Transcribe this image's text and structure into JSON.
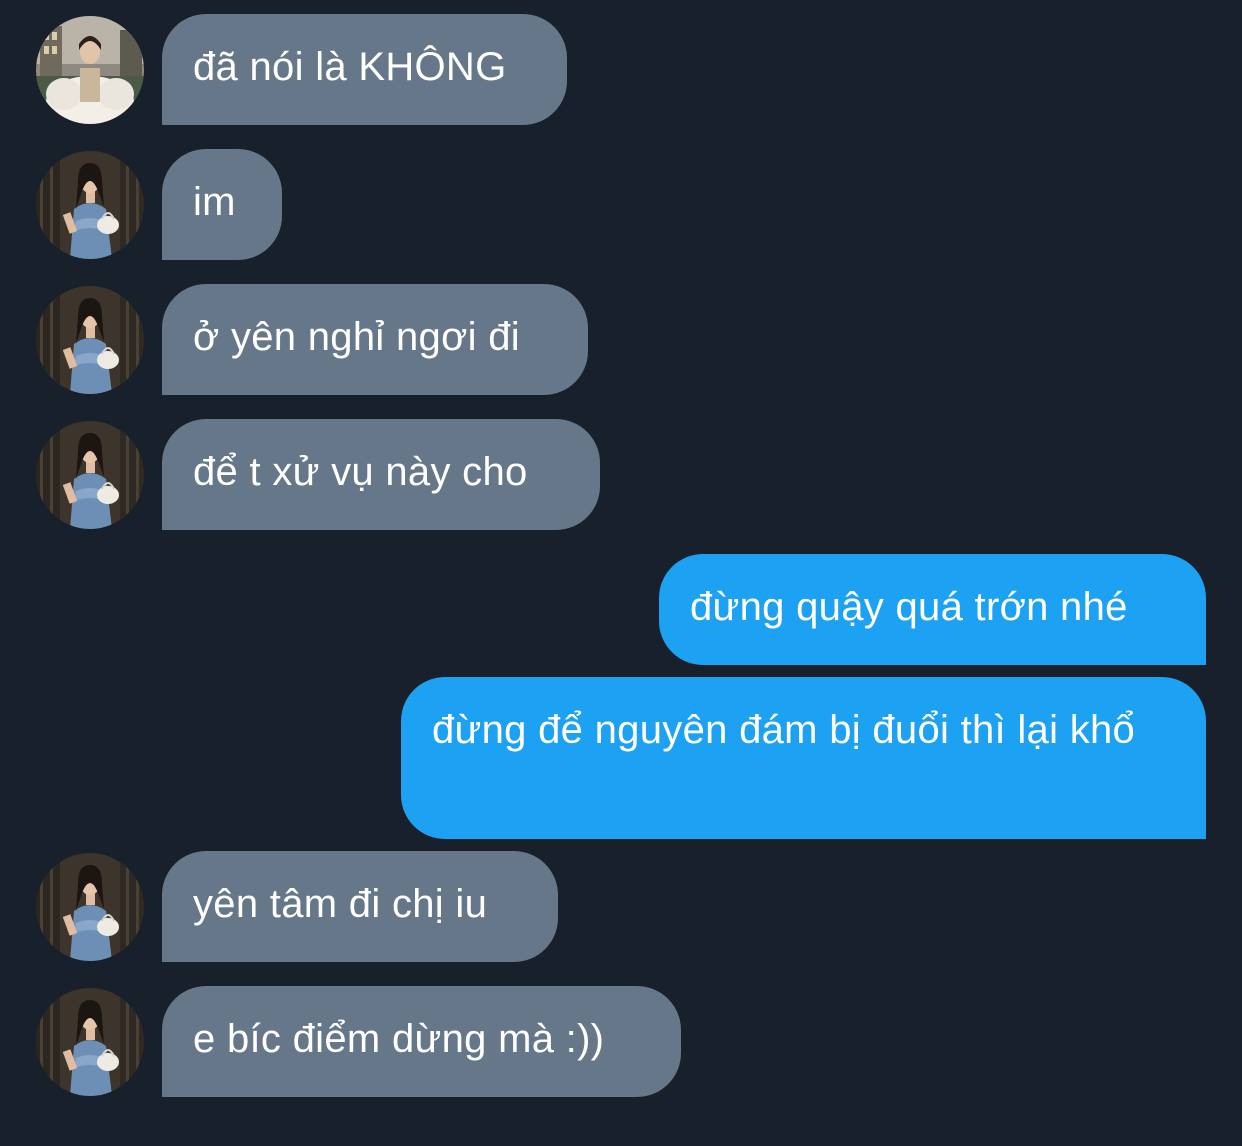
{
  "conversation": {
    "messages": [
      {
        "direction": "in",
        "avatar": "avatar-fur-coat",
        "text": "đã nói là KHÔNG"
      },
      {
        "direction": "in",
        "avatar": "avatar-denim-dress",
        "text": "im"
      },
      {
        "direction": "in",
        "avatar": "avatar-denim-dress",
        "text": "ở yên nghỉ ngơi đi"
      },
      {
        "direction": "in",
        "avatar": "avatar-denim-dress",
        "text": "để t xử vụ này cho"
      },
      {
        "direction": "out",
        "text": "đừng quậy quá trớn nhé"
      },
      {
        "direction": "out",
        "text": "đừng để nguyên đám bị đuổi thì lại khổ"
      },
      {
        "direction": "in",
        "avatar": "avatar-denim-dress",
        "text": "yên tâm đi chị iu"
      },
      {
        "direction": "in",
        "avatar": "avatar-denim-dress",
        "text": "e bíc điểm dừng mà :))"
      }
    ]
  },
  "colors": {
    "background": "#17202b",
    "incoming_bubble": "#66778a",
    "outgoing_bubble": "#1da1f2",
    "text": "#ffffff"
  }
}
